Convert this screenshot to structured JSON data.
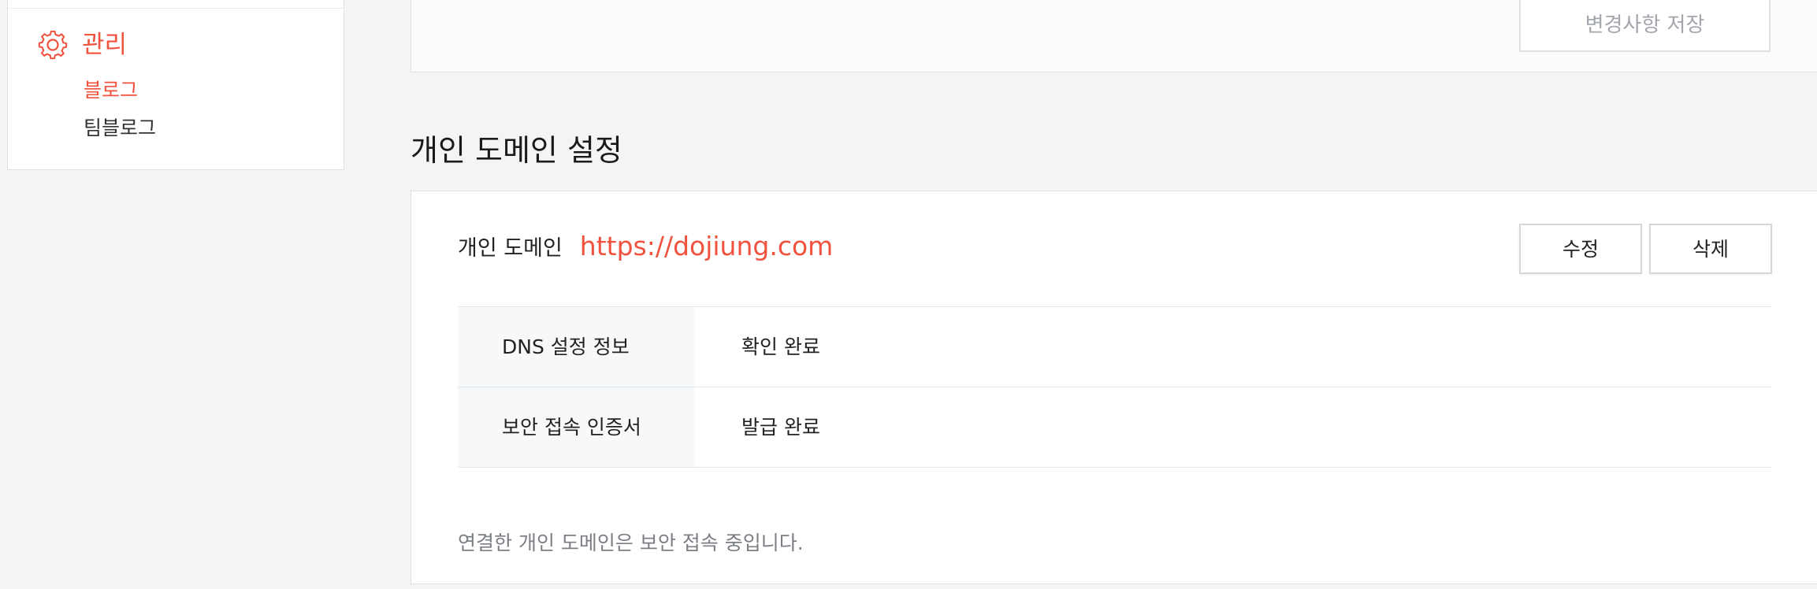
{
  "sidebar": {
    "section_title": "관리",
    "items": [
      {
        "label": "블로그",
        "active": true
      },
      {
        "label": "팀블로그",
        "active": false
      }
    ]
  },
  "top_card": {
    "save_label": "변경사항 저장"
  },
  "domain_section": {
    "title": "개인 도메인 설정",
    "domain_label": "개인 도메인",
    "domain_url": "https://dojiung.com",
    "edit_label": "수정",
    "delete_label": "삭제",
    "rows": [
      {
        "key": "DNS 설정 정보",
        "value": "확인 완료"
      },
      {
        "key": "보안 접속 인증서",
        "value": "발급 완료"
      }
    ],
    "note": "연결한 개인 도메인은 보안 접속 중입니다."
  },
  "colors": {
    "accent": "#f0523d",
    "background": "#f3f4f6",
    "border": "#dfe3e8"
  },
  "icons": {
    "section_icon": "gear-icon"
  }
}
